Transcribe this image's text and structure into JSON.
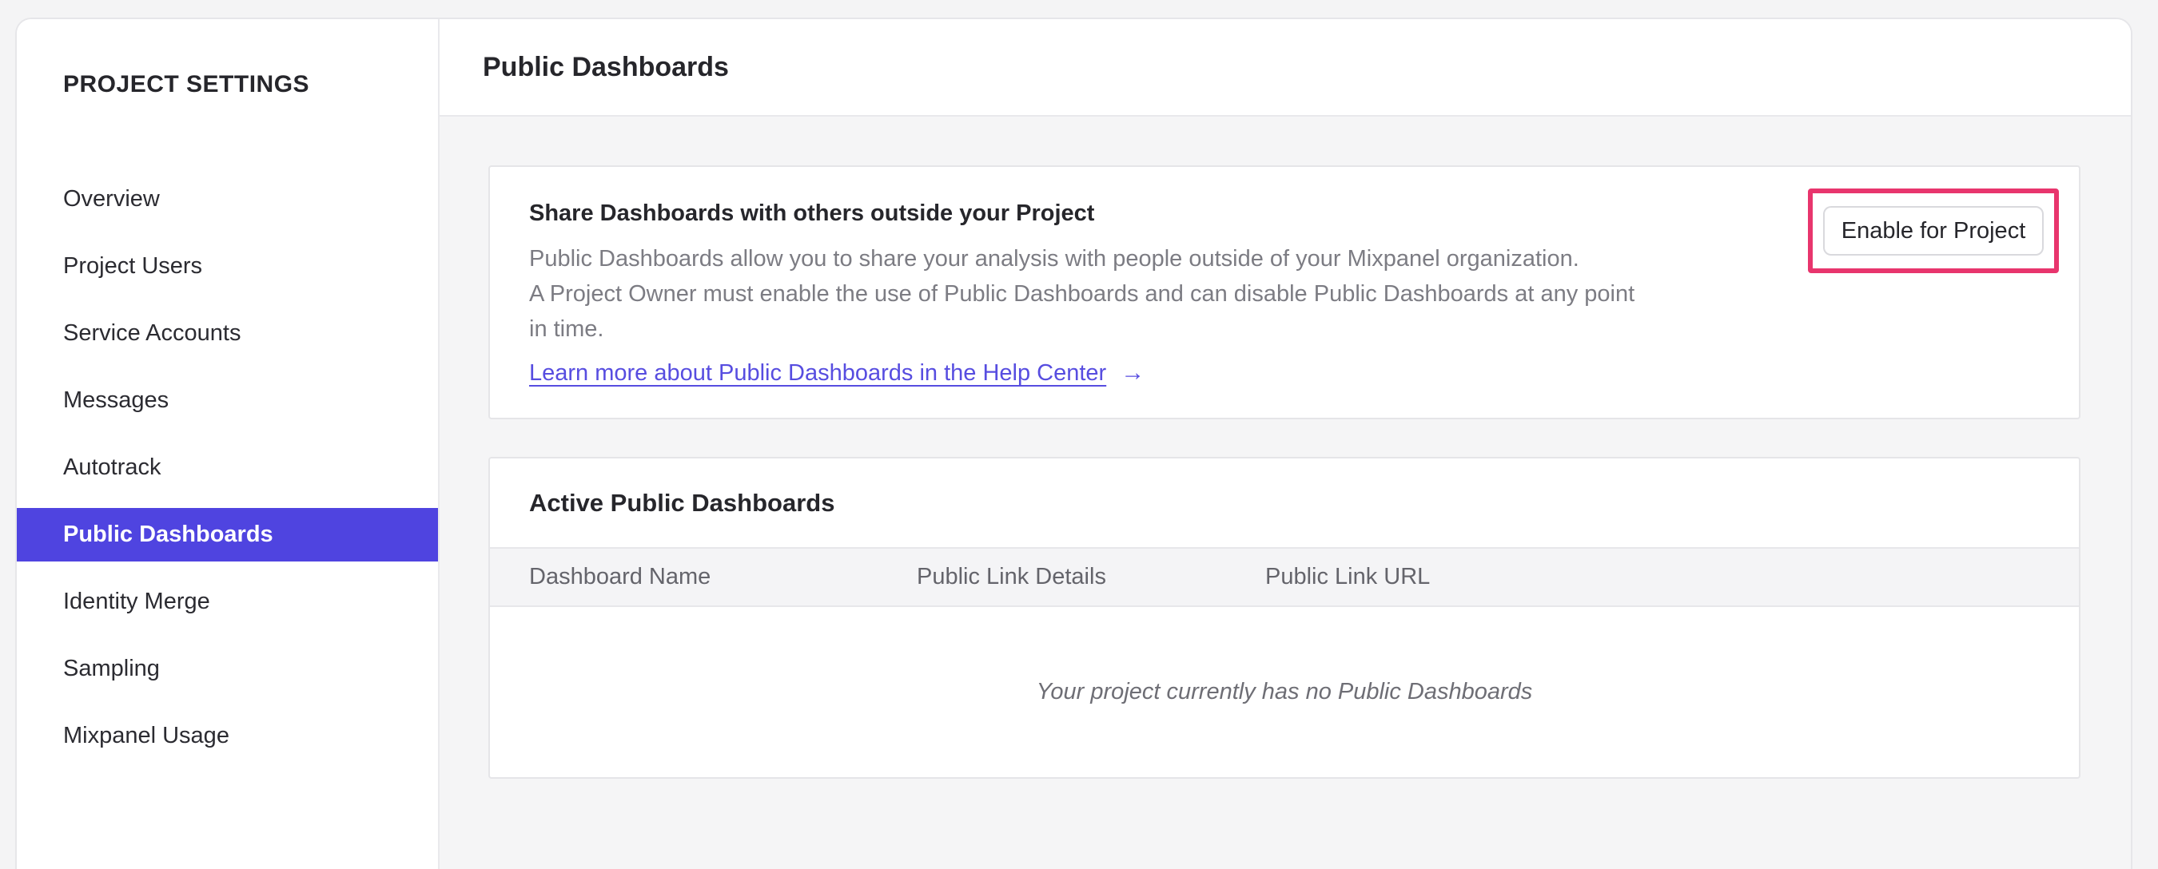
{
  "sidebar": {
    "title": "PROJECT SETTINGS",
    "items": [
      {
        "label": "Overview",
        "selected": false
      },
      {
        "label": "Project Users",
        "selected": false
      },
      {
        "label": "Service Accounts",
        "selected": false
      },
      {
        "label": "Messages",
        "selected": false
      },
      {
        "label": "Autotrack",
        "selected": false
      },
      {
        "label": "Public Dashboards",
        "selected": true
      },
      {
        "label": "Identity Merge",
        "selected": false
      },
      {
        "label": "Sampling",
        "selected": false
      },
      {
        "label": "Mixpanel Usage",
        "selected": false
      }
    ]
  },
  "header": {
    "title": "Public Dashboards"
  },
  "share_card": {
    "heading": "Share Dashboards with others outside your Project",
    "body_lines": [
      "Public Dashboards allow you to share your analysis with people outside of your Mixpanel organization.",
      "A Project Owner must enable the use of Public Dashboards and can disable Public Dashboards at any point",
      "in time."
    ],
    "link_label": "Learn more about Public Dashboards in the Help Center",
    "link_arrow": "→",
    "enable_button_label": "Enable for Project"
  },
  "active_card": {
    "heading": "Active Public Dashboards",
    "columns": [
      "Dashboard Name",
      "Public Link Details",
      "Public Link URL"
    ],
    "empty_message": "Your project currently has no Public Dashboards"
  },
  "colors": {
    "selected_nav_bg": "#4f44e0",
    "link": "#574de0",
    "annotation_pink": "#e8356d",
    "page_bg": "#f4f4f5",
    "content_bg": "#f5f5f6",
    "text_dark": "#26262b",
    "text_gray": "#7c7c83"
  }
}
